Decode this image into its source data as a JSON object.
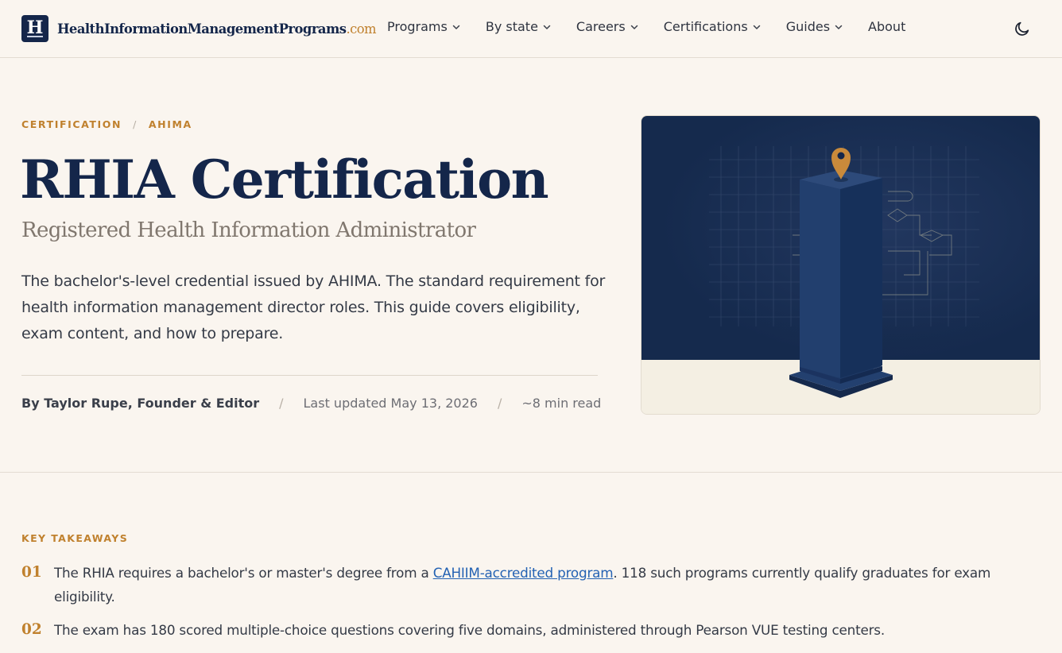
{
  "site": {
    "logo_letter": "H",
    "name": "HealthInformationManagementPrograms",
    "tld": ".com"
  },
  "nav": {
    "items": [
      {
        "label": "Programs",
        "has_dropdown": true
      },
      {
        "label": "By state",
        "has_dropdown": true
      },
      {
        "label": "Careers",
        "has_dropdown": true
      },
      {
        "label": "Certifications",
        "has_dropdown": true
      },
      {
        "label": "Guides",
        "has_dropdown": true
      },
      {
        "label": "About",
        "has_dropdown": false
      }
    ],
    "theme_toggle_icon": "moon-icon"
  },
  "breadcrumb": {
    "first": "CERTIFICATION",
    "separator": "/",
    "second": "AHIMA"
  },
  "hero": {
    "title": "RHIA Certification",
    "subtitle": "Registered Health Information Administrator",
    "lede": "The bachelor's-level credential issued by AHIMA. The standard requirement for health information management director roles. This guide covers eligibility, exam content, and how to prepare."
  },
  "byline": {
    "author": "By Taylor Rupe, Founder & Editor",
    "separator": "/",
    "updated": "Last updated May 13, 2026",
    "read_time": "~8 min read"
  },
  "key_takeaways": {
    "label": "KEY TAKEAWAYS",
    "items": [
      {
        "num": "01",
        "before": "The RHIA requires a bachelor's or master's degree from a ",
        "link": "CAHIIM-accredited program",
        "after": ". 118 such programs currently qualify graduates for exam eligibility."
      },
      {
        "num": "02",
        "text": "The exam has 180 scored multiple-choice questions covering five domains, administered through Pearson VUE testing centers."
      }
    ]
  },
  "colors": {
    "accent": "#c0812e",
    "navy": "#14264a",
    "link": "#2462b3",
    "background": "#faf5ef"
  }
}
